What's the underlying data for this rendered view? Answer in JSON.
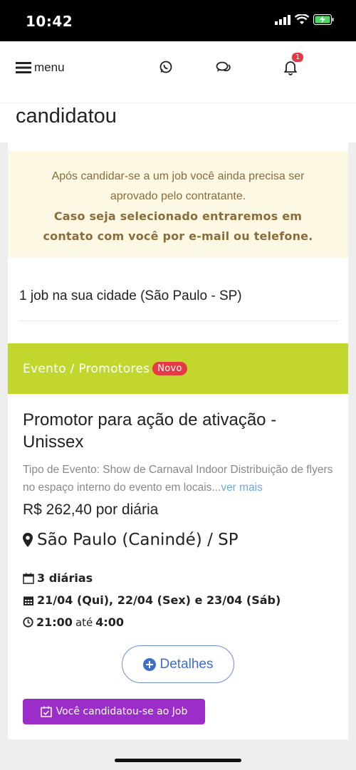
{
  "status_bar": {
    "time": "10:42"
  },
  "header": {
    "menu_label": "menu",
    "notification_count": "1"
  },
  "page": {
    "title": "candidatou"
  },
  "alert": {
    "line1": "Após candidar-se a um job você ainda precisa ser",
    "line2": "aprovado pelo contratante.",
    "line3": "Caso seja selecionado entraremos em",
    "line4": "contato com você por e-mail ou telefone."
  },
  "results": {
    "count_text": "1 job na sua cidade (São Paulo - SP)"
  },
  "job": {
    "category": "Evento / Promotores",
    "badge": "Novo",
    "title": "Promotor para ação de ativação - Unissex",
    "description": "Tipo de Evento: Show de Carnaval Indoor Distribuição de flyers no espaço interno do evento em locais...",
    "more_link": "ver mais",
    "price": "R$ 262,40 por diária",
    "location": "São Paulo (Canindé) / SP",
    "days": "3 diárias",
    "dates": "21/04 (Qui), 22/04 (Sex) e 23/04 (Sáb)",
    "time_start": "21:00",
    "time_sep": "até",
    "time_end": "4:00",
    "details_label": "Detalhes",
    "applied_label": "Você candidatou-se ao Job"
  },
  "colors": {
    "category_bg": "#c2d62e",
    "badge_red": "#e53945",
    "alert_bg": "#fcf8e3",
    "alert_text": "#8a6d3b",
    "applied_bg": "#9b2dc9",
    "details_blue": "#3f6ec9"
  }
}
